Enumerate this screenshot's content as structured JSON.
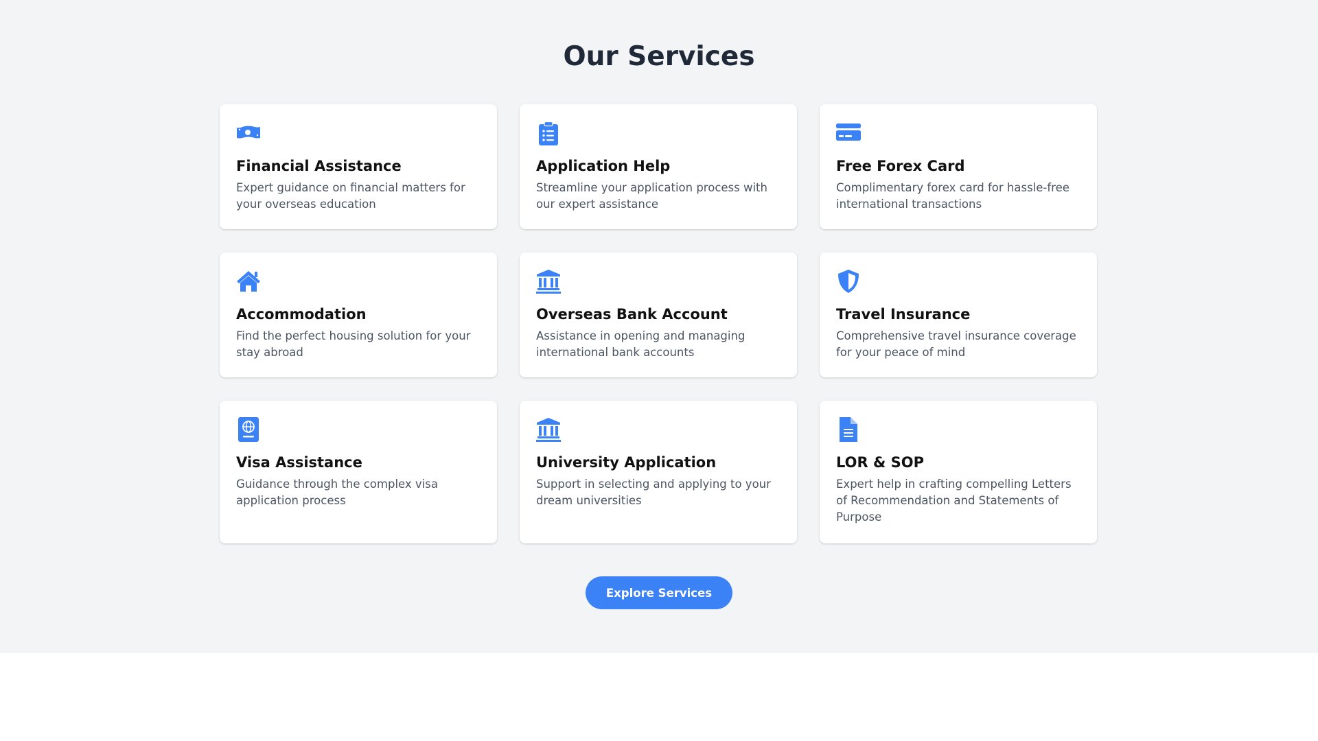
{
  "section": {
    "title": "Our Services",
    "accent_color": "#3b82f6"
  },
  "services": [
    {
      "title": "Financial Assistance",
      "description": "Expert guidance on financial matters for your overseas education",
      "icon": "money-bill-icon"
    },
    {
      "title": "Application Help",
      "description": "Streamline your application process with our expert assistance",
      "icon": "clipboard-list-icon"
    },
    {
      "title": "Free Forex Card",
      "description": "Complimentary forex card for hassle-free international transactions",
      "icon": "credit-card-icon"
    },
    {
      "title": "Accommodation",
      "description": "Find the perfect housing solution for your stay abroad",
      "icon": "home-icon"
    },
    {
      "title": "Overseas Bank Account",
      "description": "Assistance in opening and managing international bank accounts",
      "icon": "bank-icon"
    },
    {
      "title": "Travel Insurance",
      "description": "Comprehensive travel insurance coverage for your peace of mind",
      "icon": "shield-icon"
    },
    {
      "title": "Visa Assistance",
      "description": "Guidance through the complex visa application process",
      "icon": "passport-icon"
    },
    {
      "title": "University Application",
      "description": "Support in selecting and applying to your dream universities",
      "icon": "university-icon"
    },
    {
      "title": "LOR & SOP",
      "description": "Expert help in crafting compelling Letters of Recommendation and Statements of Purpose",
      "icon": "document-icon"
    }
  ],
  "cta": {
    "label": "Explore Services"
  }
}
